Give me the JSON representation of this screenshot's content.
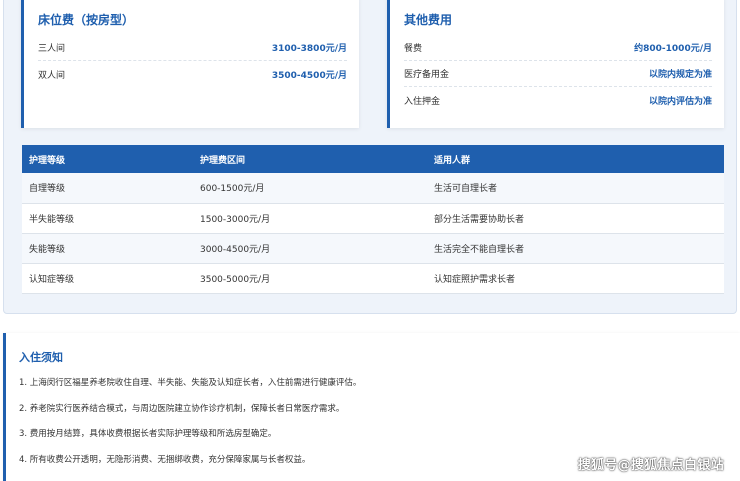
{
  "bed_fee": {
    "title": "床位费（按房型）",
    "rows": [
      {
        "label": "三人间",
        "value": "3100-3800元/月"
      },
      {
        "label": "双人间",
        "value": "3500-4500元/月"
      }
    ]
  },
  "other_fee": {
    "title": "其他费用",
    "rows": [
      {
        "label": "餐费",
        "value": "约800-1000元/月"
      },
      {
        "label": "医疗备用金",
        "value": "以院内规定为准"
      },
      {
        "label": "入住押金",
        "value": "以院内评估为准"
      }
    ]
  },
  "care_table": {
    "headers": [
      "护理等级",
      "护理费区间",
      "适用人群"
    ],
    "rows": [
      [
        "自理等级",
        "600-1500元/月",
        "生活可自理长者"
      ],
      [
        "半失能等级",
        "1500-3000元/月",
        "部分生活需要协助长者"
      ],
      [
        "失能等级",
        "3000-4500元/月",
        "生活完全不能自理长者"
      ],
      [
        "认知症等级",
        "3500-5000元/月",
        "认知症照护需求长者"
      ]
    ]
  },
  "notice": {
    "title": "入住须知",
    "items": [
      "1. 上海闵行区福星养老院收住自理、半失能、失能及认知症长者，入住前需进行健康评估。",
      "2. 养老院实行医养结合模式，与周边医院建立协作诊疗机制，保障长者日常医疗需求。",
      "3. 费用按月结算，具体收费根据长者实际护理等级和所选房型确定。",
      "4. 所有收费公开透明，无隐形消费、无捆绑收费，充分保障家属与长者权益。"
    ]
  },
  "watermark": "搜狐号@搜狐焦点白银站"
}
